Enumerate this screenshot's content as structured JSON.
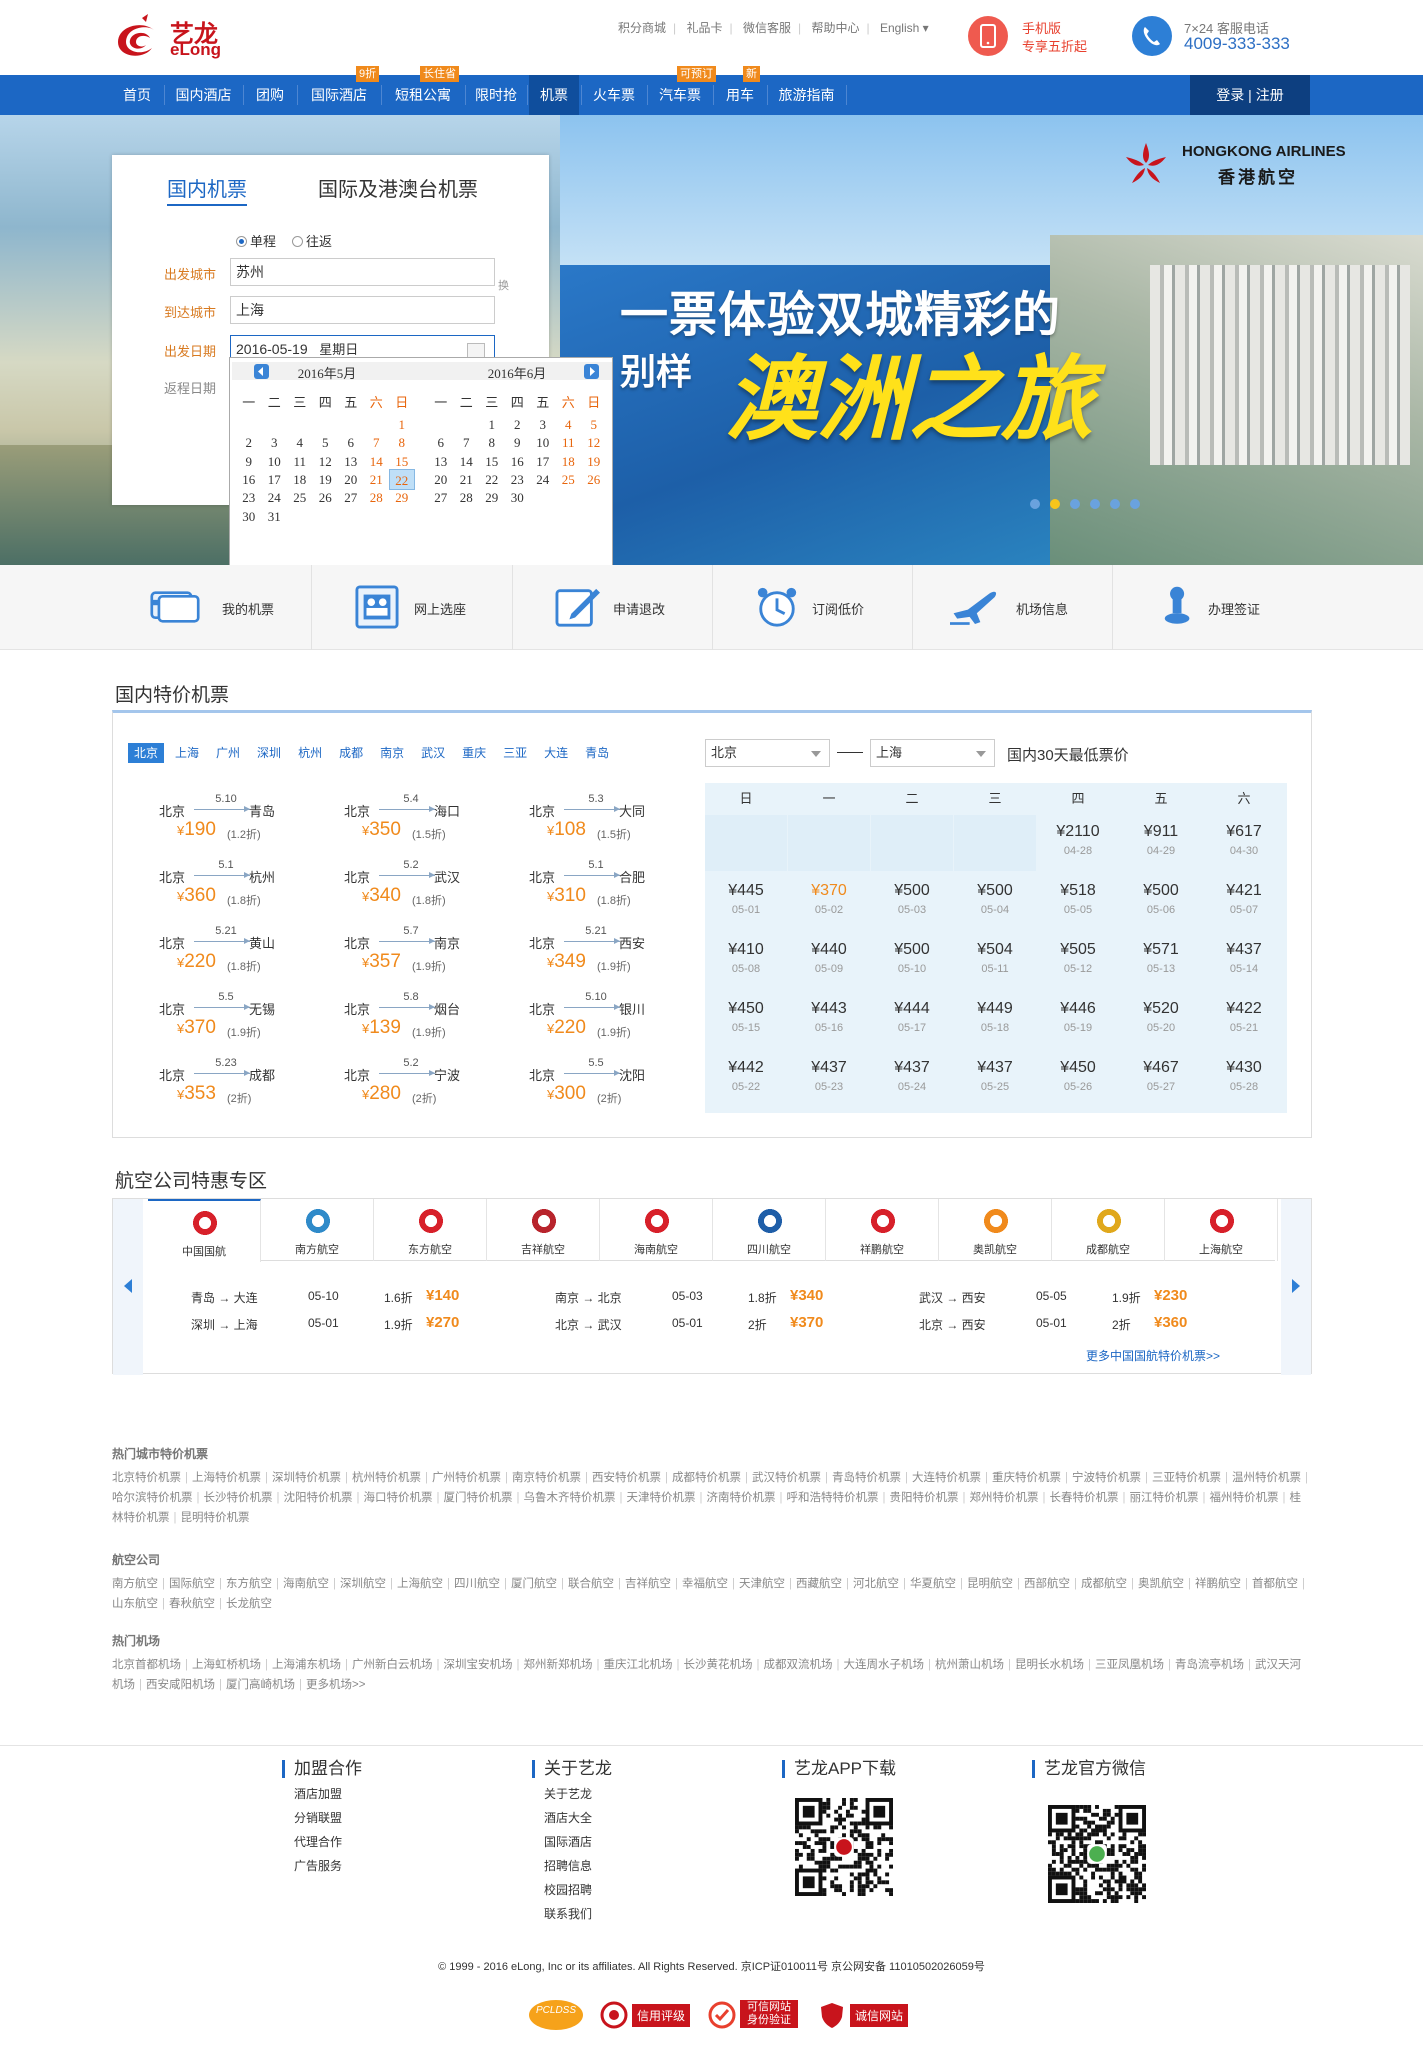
{
  "brand": {
    "name_cn": "艺龙",
    "name_en": "eLong"
  },
  "top_links": [
    "积分商城",
    "礼品卡",
    "微信客服",
    "帮助中心",
    "English"
  ],
  "mobile": {
    "line1": "手机版",
    "line2": "专享五折起"
  },
  "hotline": {
    "label": "7×24 客服电话",
    "number": "4009-333-333"
  },
  "nav": {
    "items": [
      {
        "label": "首页"
      },
      {
        "label": "国内酒店"
      },
      {
        "label": "团购"
      },
      {
        "label": "国际酒店",
        "badge": "9折"
      },
      {
        "label": "短租公寓",
        "badge": "长住省"
      },
      {
        "label": "限时抢"
      },
      {
        "label": "机票"
      },
      {
        "label": "火车票"
      },
      {
        "label": "汽车票",
        "badge": "可预订"
      },
      {
        "label": "用车",
        "badge": "新"
      },
      {
        "label": "旅游指南"
      }
    ],
    "login": "登录 | 注册"
  },
  "hero": {
    "headline_a": "一票体验",
    "headline_b": "双城精彩",
    "headline_c": "的",
    "headline_d": "别样",
    "headline_big": "澳洲之旅",
    "airline_en": "HONGKONG AIRLINES",
    "airline_cn": "香港航空",
    "colors": {
      "accent": "#1c67c4",
      "headline": "#ffe11a"
    }
  },
  "search": {
    "tab_domestic": "国内机票",
    "tab_international": "国际及港澳台机票",
    "trip_oneway": "单程",
    "trip_round": "往返",
    "label_from": "出发城市",
    "label_to": "到达城市",
    "label_date": "出发日期",
    "label_return": "返程日期",
    "from_value": "苏州",
    "to_value": "上海",
    "date_value": "2016-05-19",
    "date_weekday": "星期日",
    "swap_label": "换"
  },
  "calendar": {
    "weekdays": [
      "一",
      "二",
      "三",
      "四",
      "五",
      "六",
      "日"
    ],
    "months": [
      {
        "title": "2016年5月",
        "offset": 6,
        "days": 31,
        "selected": 22
      },
      {
        "title": "2016年6月",
        "offset": 2,
        "days": 30,
        "selected": 0
      }
    ]
  },
  "features": [
    "我的机票",
    "网上选座",
    "申请退改",
    "订阅低价",
    "机场信息",
    "办理签证"
  ],
  "domestic": {
    "title": "国内特价机票",
    "cities": [
      "北京",
      "上海",
      "广州",
      "深圳",
      "杭州",
      "成都",
      "南京",
      "武汉",
      "重庆",
      "三亚",
      "大连",
      "青岛"
    ],
    "deals": [
      {
        "from": "北京",
        "to": "青岛",
        "date": "5.10",
        "price": "190",
        "disc": "(1.2折)"
      },
      {
        "from": "北京",
        "to": "海口",
        "date": "5.4",
        "price": "350",
        "disc": "(1.5折)"
      },
      {
        "from": "北京",
        "to": "大同",
        "date": "5.3",
        "price": "108",
        "disc": "(1.5折)"
      },
      {
        "from": "北京",
        "to": "杭州",
        "date": "5.1",
        "price": "360",
        "disc": "(1.8折)"
      },
      {
        "from": "北京",
        "to": "武汉",
        "date": "5.2",
        "price": "340",
        "disc": "(1.8折)"
      },
      {
        "from": "北京",
        "to": "合肥",
        "date": "5.1",
        "price": "310",
        "disc": "(1.8折)"
      },
      {
        "from": "北京",
        "to": "黄山",
        "date": "5.21",
        "price": "220",
        "disc": "(1.8折)"
      },
      {
        "from": "北京",
        "to": "南京",
        "date": "5.7",
        "price": "357",
        "disc": "(1.9折)"
      },
      {
        "from": "北京",
        "to": "西安",
        "date": "5.21",
        "price": "349",
        "disc": "(1.9折)"
      },
      {
        "from": "北京",
        "to": "无锡",
        "date": "5.5",
        "price": "370",
        "disc": "(1.9折)"
      },
      {
        "from": "北京",
        "to": "烟台",
        "date": "5.8",
        "price": "139",
        "disc": "(1.9折)"
      },
      {
        "from": "北京",
        "to": "银川",
        "date": "5.10",
        "price": "220",
        "disc": "(1.9折)"
      },
      {
        "from": "北京",
        "to": "成都",
        "date": "5.23",
        "price": "353",
        "disc": "(2折)"
      },
      {
        "from": "北京",
        "to": "宁波",
        "date": "5.2",
        "price": "280",
        "disc": "(2折)"
      },
      {
        "from": "北京",
        "to": "沈阳",
        "date": "5.5",
        "price": "300",
        "disc": "(2折)"
      }
    ],
    "route_from": "北京",
    "route_to": "上海",
    "route_label": "国内30天最低票价",
    "weekheads": [
      "日",
      "一",
      "二",
      "三",
      "四",
      "五",
      "六"
    ],
    "price_cells": [
      {
        "p": "",
        "d": ""
      },
      {
        "p": "",
        "d": ""
      },
      {
        "p": "",
        "d": ""
      },
      {
        "p": "",
        "d": ""
      },
      {
        "p": "¥2110",
        "d": "04-28"
      },
      {
        "p": "¥911",
        "d": "04-29"
      },
      {
        "p": "¥617",
        "d": "04-30"
      },
      {
        "p": "¥445",
        "d": "05-01"
      },
      {
        "p": "¥370",
        "d": "05-02",
        "low": true
      },
      {
        "p": "¥500",
        "d": "05-03"
      },
      {
        "p": "¥500",
        "d": "05-04"
      },
      {
        "p": "¥518",
        "d": "05-05"
      },
      {
        "p": "¥500",
        "d": "05-06"
      },
      {
        "p": "¥421",
        "d": "05-07"
      },
      {
        "p": "¥410",
        "d": "05-08"
      },
      {
        "p": "¥440",
        "d": "05-09"
      },
      {
        "p": "¥500",
        "d": "05-10"
      },
      {
        "p": "¥504",
        "d": "05-11"
      },
      {
        "p": "¥505",
        "d": "05-12"
      },
      {
        "p": "¥571",
        "d": "05-13"
      },
      {
        "p": "¥437",
        "d": "05-14"
      },
      {
        "p": "¥450",
        "d": "05-15"
      },
      {
        "p": "¥443",
        "d": "05-16"
      },
      {
        "p": "¥444",
        "d": "05-17"
      },
      {
        "p": "¥449",
        "d": "05-18"
      },
      {
        "p": "¥446",
        "d": "05-19"
      },
      {
        "p": "¥520",
        "d": "05-20"
      },
      {
        "p": "¥422",
        "d": "05-21"
      },
      {
        "p": "¥442",
        "d": "05-22"
      },
      {
        "p": "¥437",
        "d": "05-23"
      },
      {
        "p": "¥437",
        "d": "05-24"
      },
      {
        "p": "¥437",
        "d": "05-25"
      },
      {
        "p": "¥450",
        "d": "05-26"
      },
      {
        "p": "¥467",
        "d": "05-27"
      },
      {
        "p": "¥430",
        "d": "05-28"
      }
    ]
  },
  "airline_section": {
    "title": "航空公司特惠专区",
    "airlines": [
      {
        "name": "中国国航",
        "color": "#d7202a"
      },
      {
        "name": "南方航空",
        "color": "#2f8ac9"
      },
      {
        "name": "东方航空",
        "color": "#d7202a"
      },
      {
        "name": "吉祥航空",
        "color": "#b8242c"
      },
      {
        "name": "海南航空",
        "color": "#d7202a"
      },
      {
        "name": "四川航空",
        "color": "#1f5ea8"
      },
      {
        "name": "祥鹏航空",
        "color": "#d7202a"
      },
      {
        "name": "奥凯航空",
        "color": "#f08a1c"
      },
      {
        "name": "成都航空",
        "color": "#e0a81c"
      },
      {
        "name": "上海航空",
        "color": "#d7202a"
      }
    ],
    "deals": [
      {
        "r": "青岛 → 大连",
        "d": "05-10",
        "z": "1.6折",
        "p": "¥140"
      },
      {
        "r": "南京 → 北京",
        "d": "05-03",
        "z": "1.8折",
        "p": "¥340"
      },
      {
        "r": "武汉 → 西安",
        "d": "05-05",
        "z": "1.9折",
        "p": "¥230"
      },
      {
        "r": "深圳 → 上海",
        "d": "05-01",
        "z": "1.9折",
        "p": "¥270"
      },
      {
        "r": "北京 → 武汉",
        "d": "05-01",
        "z": "2折",
        "p": "¥370"
      },
      {
        "r": "北京 → 西安",
        "d": "05-01",
        "z": "2折",
        "p": "¥360"
      }
    ],
    "more": "更多中国国航特价机票>>"
  },
  "links": {
    "hot_city_title": "热门城市特价机票",
    "hot_city": [
      "北京特价机票",
      "上海特价机票",
      "深圳特价机票",
      "杭州特价机票",
      "广州特价机票",
      "南京特价机票",
      "西安特价机票",
      "成都特价机票",
      "武汉特价机票",
      "青岛特价机票",
      "大连特价机票",
      "重庆特价机票",
      "宁波特价机票",
      "三亚特价机票",
      "温州特价机票",
      "哈尔滨特价机票",
      "长沙特价机票",
      "沈阳特价机票",
      "海口特价机票",
      "厦门特价机票",
      "乌鲁木齐特价机票",
      "天津特价机票",
      "济南特价机票",
      "呼和浩特特价机票",
      "贵阳特价机票",
      "郑州特价机票",
      "长春特价机票",
      "丽江特价机票",
      "福州特价机票",
      "桂林特价机票",
      "昆明特价机票"
    ],
    "airline_title": "航空公司",
    "airline": [
      "南方航空",
      "国际航空",
      "东方航空",
      "海南航空",
      "深圳航空",
      "上海航空",
      "四川航空",
      "厦门航空",
      "联合航空",
      "吉祥航空",
      "幸福航空",
      "天津航空",
      "西藏航空",
      "河北航空",
      "华夏航空",
      "昆明航空",
      "西部航空",
      "成都航空",
      "奥凯航空",
      "祥鹏航空",
      "首都航空",
      "山东航空",
      "春秋航空",
      "长龙航空"
    ],
    "airport_title": "热门机场",
    "airport": [
      "北京首都机场",
      "上海虹桥机场",
      "上海浦东机场",
      "广州新白云机场",
      "深圳宝安机场",
      "郑州新郑机场",
      "重庆江北机场",
      "长沙黄花机场",
      "成都双流机场",
      "大连周水子机场",
      "杭州萧山机场",
      "昆明长水机场",
      "三亚凤凰机场",
      "青岛流亭机场",
      "武汉天河机场",
      "西安咸阳机场",
      "厦门高崎机场",
      "更多机场>>"
    ]
  },
  "footer": {
    "col1_title": "加盟合作",
    "col1": [
      "酒店加盟",
      "分销联盟",
      "代理合作",
      "广告服务"
    ],
    "col2_title": "关于艺龙",
    "col2": [
      "关于艺龙",
      "酒店大全",
      "国际酒店",
      "招聘信息",
      "校园招聘",
      "联系我们"
    ],
    "col3_title": "艺龙APP下载",
    "col4_title": "艺龙官方微信",
    "copyright": "© 1999 - 2016 eLong, Inc or its affiliates. All Rights Reserved. 京ICP证010011号 京公网安备 11010502026059号",
    "badges": [
      "PCLDSS",
      "信用评级",
      "可信网站 身份验证",
      "诚信网站"
    ]
  }
}
